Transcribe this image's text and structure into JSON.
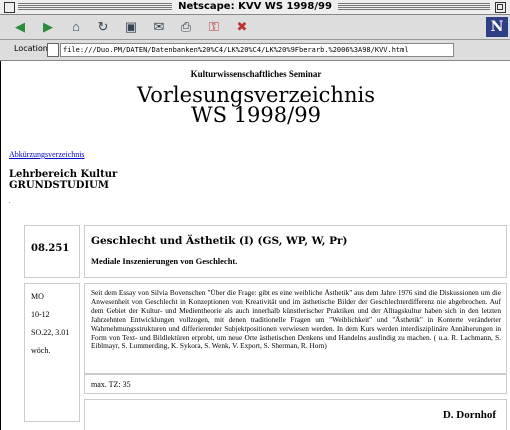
{
  "window": {
    "title": "Netscape: KVV WS 1998/99"
  },
  "toolbar": {
    "buttons": [
      {
        "name": "back",
        "icon": "back-arrow-icon"
      },
      {
        "name": "forward",
        "icon": "forward-arrow-icon"
      },
      {
        "name": "home",
        "icon": "home-icon"
      },
      {
        "name": "reload",
        "icon": "reload-icon"
      },
      {
        "name": "load-images",
        "icon": "images-icon"
      },
      {
        "name": "open",
        "icon": "open-icon"
      },
      {
        "name": "print",
        "icon": "print-icon"
      },
      {
        "name": "find",
        "icon": "find-icon"
      },
      {
        "name": "stop",
        "icon": "stop-icon"
      }
    ],
    "logo": "N"
  },
  "location": {
    "label": "Location :",
    "url": "file:///Duo.PM/DATEN/Datenbanken%20%C4/LK%20%C4/LK%20%9Fberarb.%2006%3A98/KVV.html"
  },
  "page": {
    "seminar": "Kulturwissenschaftliches Seminar",
    "heading_line1": "Vorlesungsverzeichnis",
    "heading_line2": "WS 1998/99",
    "abbrev_link": "Abkürzungsverzeichnis",
    "bereich_line1": "Lehrbereich Kultur",
    "bereich_line2": "GRUNDSTUDIUM",
    "dot": "."
  },
  "course": {
    "number": "08.251",
    "title": "Geschlecht und Ästhetik (I) (GS, WP, W, Pr)",
    "subtitle": "Mediale Inszenierungen von Geschlecht.",
    "day": "MO",
    "time": "10-12",
    "room": "SO.22, 3.01",
    "rhythm": "wöch.",
    "description": "Seit dem Essay von Silvia Bovenschen \"Über die Frage: gibt es eine weibliche Ästhetik\" aus dem Jahre 1976 sind die Diskussionen um die Anwesenheit von Geschlecht in Konzeptionen von Kreativität und im ästhetische Bilder der Geschlechterdifferenz nie abgebrochen. Auf dem Gebiet der Kultur- und Medientheorie als auch innerhalb künstlerischer Praktiken und der Alltagskultur haben sich in den letzten Jahrzehnten Entwicklungen vollzogen, mit denen traditionelle Fragen um \"Weiblichkeit\" und \"Ästhetik\" in Konterte veränderter Wahrnehmungsstrukturen und differierender Subjektpositionen verwiesen werden. In dem Kurs werden interdisziplinäre Annäherungen in Form von Text- und Bildlektüren erprobt, um neue Orte ästhetischen Denkens und Handelns ausfindig zu machen. ( u.a. R. Lachmann, S. Eiblmayr, S. Lummerding, K. Sykora, S. Wenk, V. Export, S. Sherman, R. Horn)",
    "max": "max. TZ: 35",
    "lecturer": "D. Dornhof"
  }
}
